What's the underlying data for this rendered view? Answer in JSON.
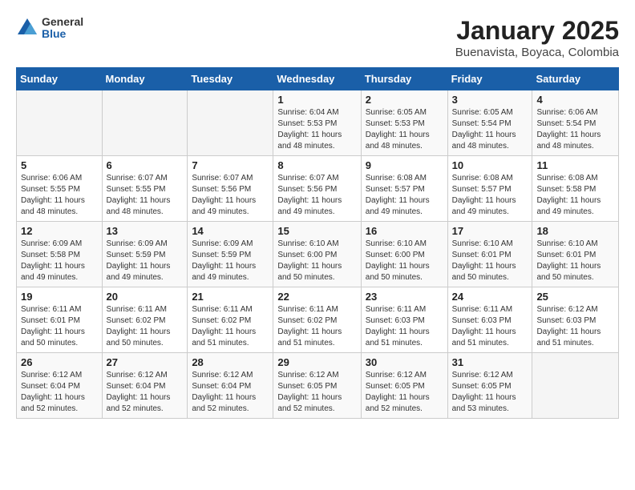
{
  "logo": {
    "general": "General",
    "blue": "Blue"
  },
  "title": "January 2025",
  "subtitle": "Buenavista, Boyaca, Colombia",
  "headers": [
    "Sunday",
    "Monday",
    "Tuesday",
    "Wednesday",
    "Thursday",
    "Friday",
    "Saturday"
  ],
  "weeks": [
    [
      {
        "day": "",
        "info": ""
      },
      {
        "day": "",
        "info": ""
      },
      {
        "day": "",
        "info": ""
      },
      {
        "day": "1",
        "info": "Sunrise: 6:04 AM\nSunset: 5:53 PM\nDaylight: 11 hours and 48 minutes."
      },
      {
        "day": "2",
        "info": "Sunrise: 6:05 AM\nSunset: 5:53 PM\nDaylight: 11 hours and 48 minutes."
      },
      {
        "day": "3",
        "info": "Sunrise: 6:05 AM\nSunset: 5:54 PM\nDaylight: 11 hours and 48 minutes."
      },
      {
        "day": "4",
        "info": "Sunrise: 6:06 AM\nSunset: 5:54 PM\nDaylight: 11 hours and 48 minutes."
      }
    ],
    [
      {
        "day": "5",
        "info": "Sunrise: 6:06 AM\nSunset: 5:55 PM\nDaylight: 11 hours and 48 minutes."
      },
      {
        "day": "6",
        "info": "Sunrise: 6:07 AM\nSunset: 5:55 PM\nDaylight: 11 hours and 48 minutes."
      },
      {
        "day": "7",
        "info": "Sunrise: 6:07 AM\nSunset: 5:56 PM\nDaylight: 11 hours and 49 minutes."
      },
      {
        "day": "8",
        "info": "Sunrise: 6:07 AM\nSunset: 5:56 PM\nDaylight: 11 hours and 49 minutes."
      },
      {
        "day": "9",
        "info": "Sunrise: 6:08 AM\nSunset: 5:57 PM\nDaylight: 11 hours and 49 minutes."
      },
      {
        "day": "10",
        "info": "Sunrise: 6:08 AM\nSunset: 5:57 PM\nDaylight: 11 hours and 49 minutes."
      },
      {
        "day": "11",
        "info": "Sunrise: 6:08 AM\nSunset: 5:58 PM\nDaylight: 11 hours and 49 minutes."
      }
    ],
    [
      {
        "day": "12",
        "info": "Sunrise: 6:09 AM\nSunset: 5:58 PM\nDaylight: 11 hours and 49 minutes."
      },
      {
        "day": "13",
        "info": "Sunrise: 6:09 AM\nSunset: 5:59 PM\nDaylight: 11 hours and 49 minutes."
      },
      {
        "day": "14",
        "info": "Sunrise: 6:09 AM\nSunset: 5:59 PM\nDaylight: 11 hours and 49 minutes."
      },
      {
        "day": "15",
        "info": "Sunrise: 6:10 AM\nSunset: 6:00 PM\nDaylight: 11 hours and 50 minutes."
      },
      {
        "day": "16",
        "info": "Sunrise: 6:10 AM\nSunset: 6:00 PM\nDaylight: 11 hours and 50 minutes."
      },
      {
        "day": "17",
        "info": "Sunrise: 6:10 AM\nSunset: 6:01 PM\nDaylight: 11 hours and 50 minutes."
      },
      {
        "day": "18",
        "info": "Sunrise: 6:10 AM\nSunset: 6:01 PM\nDaylight: 11 hours and 50 minutes."
      }
    ],
    [
      {
        "day": "19",
        "info": "Sunrise: 6:11 AM\nSunset: 6:01 PM\nDaylight: 11 hours and 50 minutes."
      },
      {
        "day": "20",
        "info": "Sunrise: 6:11 AM\nSunset: 6:02 PM\nDaylight: 11 hours and 50 minutes."
      },
      {
        "day": "21",
        "info": "Sunrise: 6:11 AM\nSunset: 6:02 PM\nDaylight: 11 hours and 51 minutes."
      },
      {
        "day": "22",
        "info": "Sunrise: 6:11 AM\nSunset: 6:02 PM\nDaylight: 11 hours and 51 minutes."
      },
      {
        "day": "23",
        "info": "Sunrise: 6:11 AM\nSunset: 6:03 PM\nDaylight: 11 hours and 51 minutes."
      },
      {
        "day": "24",
        "info": "Sunrise: 6:11 AM\nSunset: 6:03 PM\nDaylight: 11 hours and 51 minutes."
      },
      {
        "day": "25",
        "info": "Sunrise: 6:12 AM\nSunset: 6:03 PM\nDaylight: 11 hours and 51 minutes."
      }
    ],
    [
      {
        "day": "26",
        "info": "Sunrise: 6:12 AM\nSunset: 6:04 PM\nDaylight: 11 hours and 52 minutes."
      },
      {
        "day": "27",
        "info": "Sunrise: 6:12 AM\nSunset: 6:04 PM\nDaylight: 11 hours and 52 minutes."
      },
      {
        "day": "28",
        "info": "Sunrise: 6:12 AM\nSunset: 6:04 PM\nDaylight: 11 hours and 52 minutes."
      },
      {
        "day": "29",
        "info": "Sunrise: 6:12 AM\nSunset: 6:05 PM\nDaylight: 11 hours and 52 minutes."
      },
      {
        "day": "30",
        "info": "Sunrise: 6:12 AM\nSunset: 6:05 PM\nDaylight: 11 hours and 52 minutes."
      },
      {
        "day": "31",
        "info": "Sunrise: 6:12 AM\nSunset: 6:05 PM\nDaylight: 11 hours and 53 minutes."
      },
      {
        "day": "",
        "info": ""
      }
    ]
  ]
}
